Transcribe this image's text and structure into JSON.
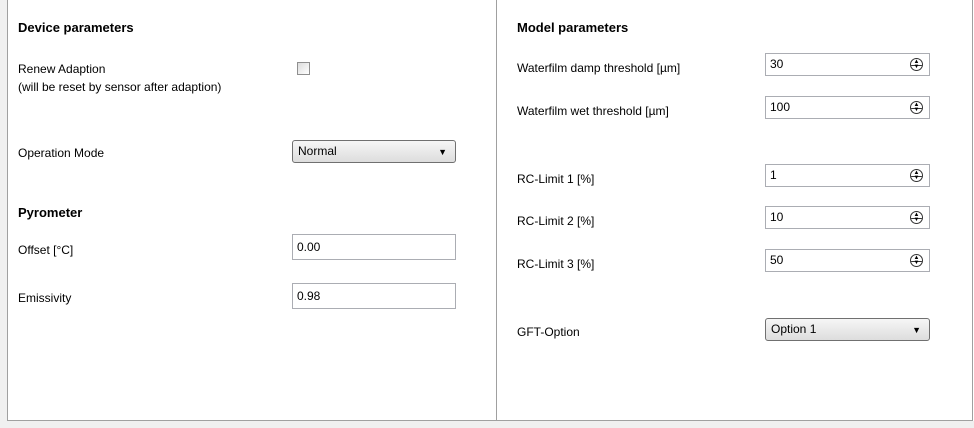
{
  "device": {
    "heading": "Device parameters",
    "renew_label": "Renew Adaption",
    "renew_note": "(will be reset by sensor after adaption)",
    "renew_checked": false,
    "operation_mode_label": "Operation Mode",
    "operation_mode_value": "Normal"
  },
  "pyrometer": {
    "heading": "Pyrometer",
    "offset_label": "Offset [°C]",
    "offset_value": "0.00",
    "emissivity_label": "Emissivity",
    "emissivity_value": "0.98"
  },
  "model": {
    "heading": "Model parameters",
    "fields": [
      {
        "label": "Waterfilm damp threshold [µm]",
        "value": "30"
      },
      {
        "label": "Waterfilm wet threshold [µm]",
        "value": "100"
      },
      {
        "label": "RC-Limit 1 [%]",
        "value": "1"
      },
      {
        "label": "RC-Limit 2 [%]",
        "value": "10"
      },
      {
        "label": "RC-Limit 3 [%]",
        "value": "50"
      }
    ],
    "gft_label": "GFT-Option",
    "gft_value": "Option 1"
  },
  "icons": {
    "dropdown": "chevron-down-icon",
    "spin": "spin-updown-icon"
  },
  "colors": {
    "border": "#a0a0a0",
    "background": "#ffffff"
  }
}
